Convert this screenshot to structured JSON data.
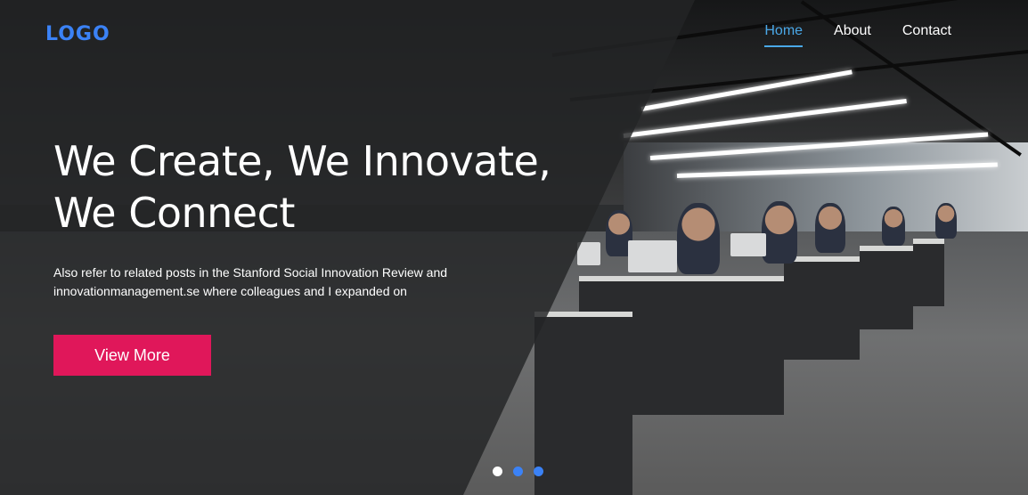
{
  "brand": {
    "logo_text": "LOGO"
  },
  "nav": {
    "items": [
      {
        "label": "Home",
        "active": true
      },
      {
        "label": "About",
        "active": false
      },
      {
        "label": "Contact",
        "active": false
      }
    ]
  },
  "hero": {
    "headline_line1": "We Create, We Innovate,",
    "headline_line2": "We Connect",
    "subtext_line1": "Also refer to related posts in the Stanford Social Innovation Review and",
    "subtext_line2": "innovationmanagement.se where colleagues and I expanded on",
    "button_label": "View More",
    "background_image": "open-plan office with people working at laptops"
  },
  "carousel": {
    "slide_count": 3,
    "active_index": 0
  },
  "colors": {
    "accent_blue": "#3b82f6",
    "nav_active": "#4aa8e8",
    "button": "#e0175a",
    "overlay": "#232426",
    "text": "#ffffff"
  }
}
